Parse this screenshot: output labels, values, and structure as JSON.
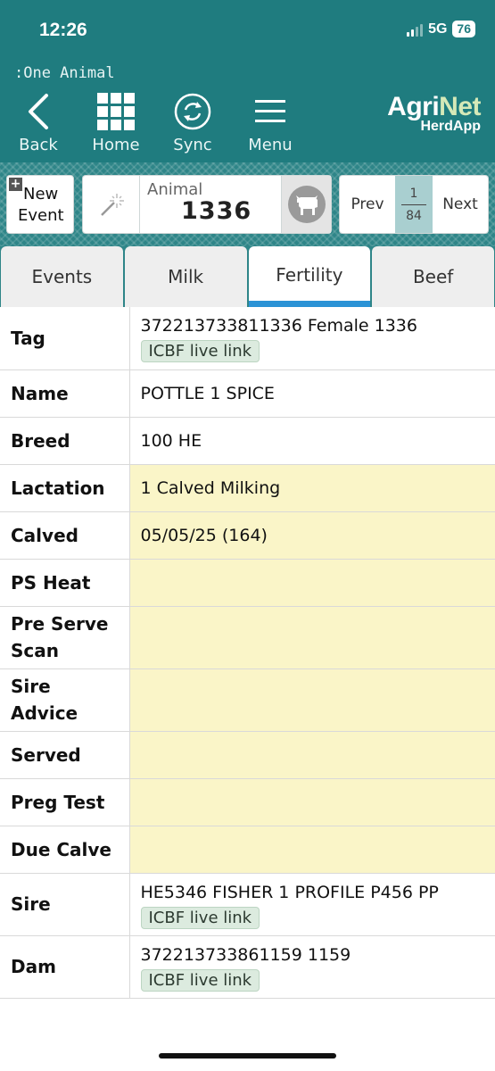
{
  "status_bar": {
    "time": "12:26",
    "network": "5G",
    "battery": "76"
  },
  "app_title": ":One Animal",
  "nav": {
    "back": "Back",
    "home": "Home",
    "sync": "Sync",
    "menu": "Menu"
  },
  "logo": {
    "agri": "Agri",
    "net": "Net",
    "sub": "HerdApp"
  },
  "toolbar": {
    "new_event_line1": "New",
    "new_event_line2": "Event",
    "animal_label": "Animal",
    "animal_value": "1336",
    "prev": "Prev",
    "next": "Next",
    "page_current": "1",
    "page_total": "84"
  },
  "tabs": [
    {
      "label": "Events",
      "active": false
    },
    {
      "label": "Milk",
      "active": false
    },
    {
      "label": "Fertility",
      "active": true
    },
    {
      "label": "Beef",
      "active": false
    }
  ],
  "details": {
    "tag": {
      "label": "Tag",
      "value": "372213733811336 Female 1336",
      "link": "ICBF live link"
    },
    "name": {
      "label": "Name",
      "value": "POTTLE 1 SPICE"
    },
    "breed": {
      "label": "Breed",
      "value": "100 HE"
    },
    "lactation": {
      "label": "Lactation",
      "value": "1 Calved Milking"
    },
    "calved": {
      "label": "Calved",
      "value": "05/05/25 (164)"
    },
    "ps_heat": {
      "label": "PS Heat",
      "value": ""
    },
    "pre_serve_scan": {
      "label_1": "Pre Serve",
      "label_2": "Scan",
      "value": ""
    },
    "sire_advice": {
      "label_1": "Sire",
      "label_2": "Advice",
      "value": ""
    },
    "served": {
      "label": "Served",
      "value": ""
    },
    "preg_test": {
      "label": "Preg Test",
      "value": ""
    },
    "due_calve": {
      "label": "Due Calve",
      "value": ""
    },
    "sire": {
      "label": "Sire",
      "value": "HE5346 FISHER 1 PROFILE P456 PP",
      "link": "ICBF live link"
    },
    "dam": {
      "label": "Dam",
      "value": "372213733861159 1159",
      "link": "ICBF live link"
    }
  },
  "colors": {
    "header": "#1f7c7f",
    "highlight_row": "#faf5c8",
    "active_tab_bar": "#2b93d6",
    "link_badge": "#dcebdf"
  }
}
